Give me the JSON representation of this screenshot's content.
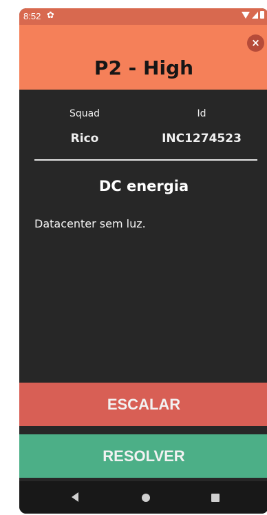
{
  "status_bar": {
    "time": "8:52",
    "icons": [
      "settings-gear-icon",
      "wifi-icon",
      "signal-icon",
      "battery-icon"
    ]
  },
  "header": {
    "priority": "P2 - High",
    "close_label": "×",
    "color": "#f58059"
  },
  "details": {
    "squad_label": "Squad",
    "squad_value": "Rico",
    "id_label": "Id",
    "id_value": "INC1274523"
  },
  "incident": {
    "title": "DC energia",
    "description": "Datacenter sem luz."
  },
  "actions": {
    "escalate_label": "ESCALAR",
    "escalate_color": "#d85f55",
    "resolve_label": "RESOLVER",
    "resolve_color": "#4caf87"
  },
  "nav": {
    "icons": [
      "back-icon",
      "home-icon",
      "recents-icon"
    ]
  }
}
